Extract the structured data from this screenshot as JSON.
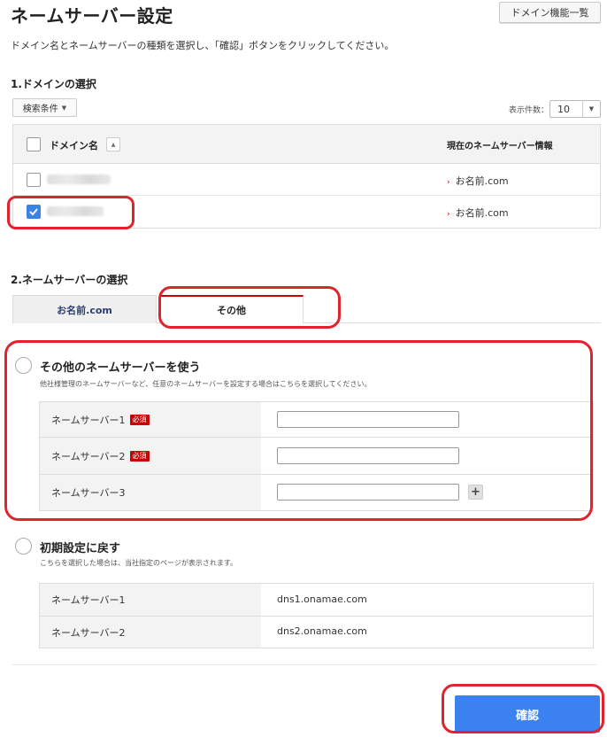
{
  "header": {
    "title": "ネームサーバー設定",
    "domain_list_button": "ドメイン機能一覧",
    "description": "ドメイン名とネームサーバーの種類を選択し、「確認」ボタンをクリックしてください。"
  },
  "domain_section": {
    "title": "1.ドメインの選択",
    "filter_button": "検索条件",
    "display_count_label": "表示件数：",
    "display_count_value": "10",
    "columns": {
      "domain": "ドメイン名",
      "current_ns": "現在のネームサーバー情報"
    },
    "rows": [
      {
        "checked": false,
        "current_ns": "お名前.com"
      },
      {
        "checked": true,
        "current_ns": "お名前.com"
      }
    ]
  },
  "ns_section": {
    "title": "2.ネームサーバーの選択",
    "tabs": [
      {
        "label": "お名前.com",
        "active": false
      },
      {
        "label": "その他",
        "active": true
      }
    ],
    "other_option": {
      "title": "その他のネームサーバーを使う",
      "description": "他社様管理のネームサーバーなど、任意のネームサーバーを設定する場合はこちらを選択してください。",
      "required_badge": "必須",
      "fields": [
        {
          "label": "ネームサーバー1",
          "required": true,
          "value": ""
        },
        {
          "label": "ネームサーバー2",
          "required": true,
          "value": ""
        },
        {
          "label": "ネームサーバー3",
          "required": false,
          "value": ""
        }
      ],
      "add_button": "+"
    },
    "default_option": {
      "title": "初期設定に戻す",
      "description": "こちらを選択した場合は、当社指定のページが表示されます。",
      "fields": [
        {
          "label": "ネームサーバー1",
          "value": "dns1.onamae.com"
        },
        {
          "label": "ネームサーバー2",
          "value": "dns2.onamae.com"
        }
      ]
    }
  },
  "footer": {
    "confirm_button": "確認"
  },
  "colors": {
    "accent_blue": "#3b82f0",
    "required_red": "#cc0000",
    "highlight_red": "#e0242e"
  },
  "icons": [
    "caret-down-icon",
    "sort-up-icon",
    "checkmark-icon",
    "arrow-right-icon",
    "plus-icon"
  ]
}
